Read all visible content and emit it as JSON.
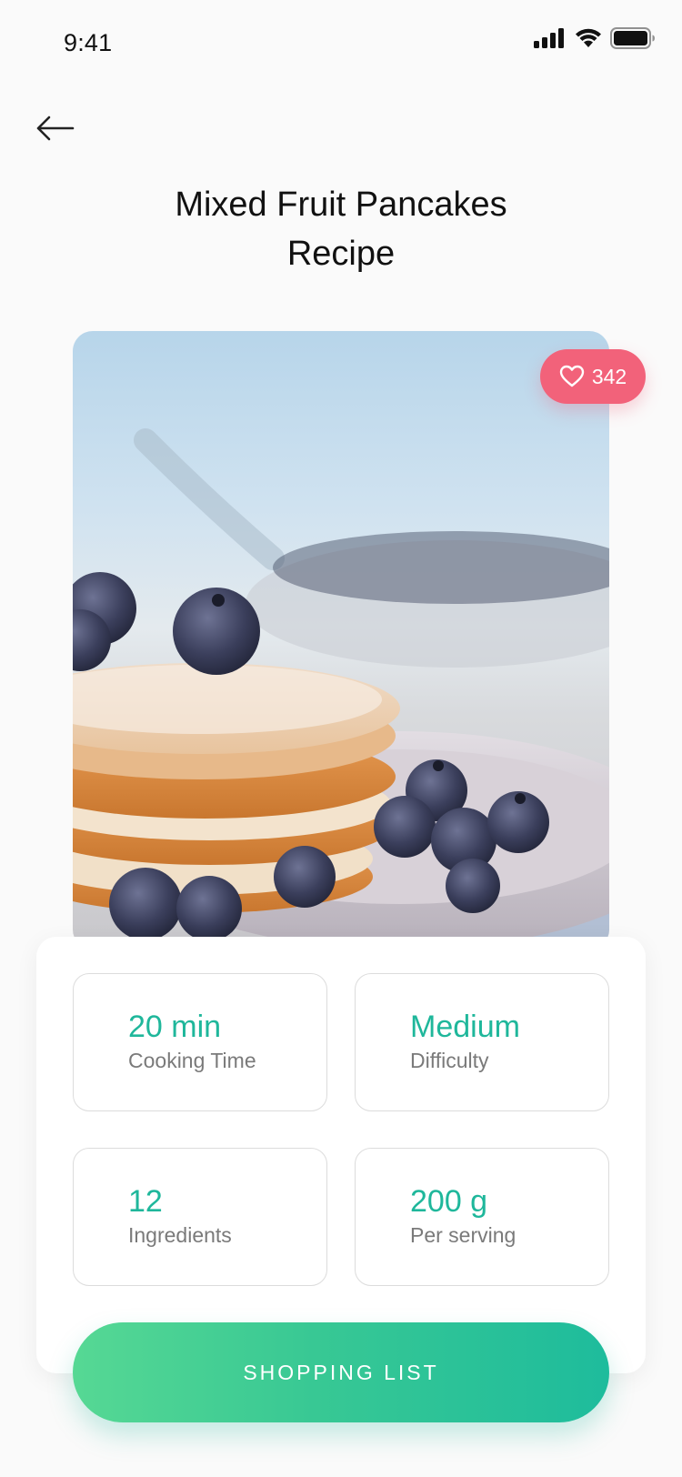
{
  "status_bar": {
    "time": "9:41",
    "icons": [
      "cellular-signal-icon",
      "wifi-icon",
      "battery-icon"
    ]
  },
  "nav": {
    "back_icon": "arrow-left-icon"
  },
  "header": {
    "title_line1": "Mixed Fruit Pancakes",
    "title_line2": "Recipe"
  },
  "hero": {
    "image_subject": "pancakes with blueberries",
    "likes": {
      "icon": "heart-outline-icon",
      "count": "342",
      "color": "#f2627a"
    }
  },
  "stats": [
    {
      "value": "20 min",
      "label": "Cooking Time"
    },
    {
      "value": "Medium",
      "label": "Difficulty"
    },
    {
      "value": "12",
      "label": "Ingredients"
    },
    {
      "value": "200 g",
      "label": "Per serving"
    }
  ],
  "actions": {
    "shopping_list_label": "SHOPPING LIST"
  },
  "colors": {
    "accent": "#1fb79b",
    "gradient_start": "#56d894",
    "gradient_end": "#1ebc9c",
    "like_badge": "#f2627a"
  }
}
